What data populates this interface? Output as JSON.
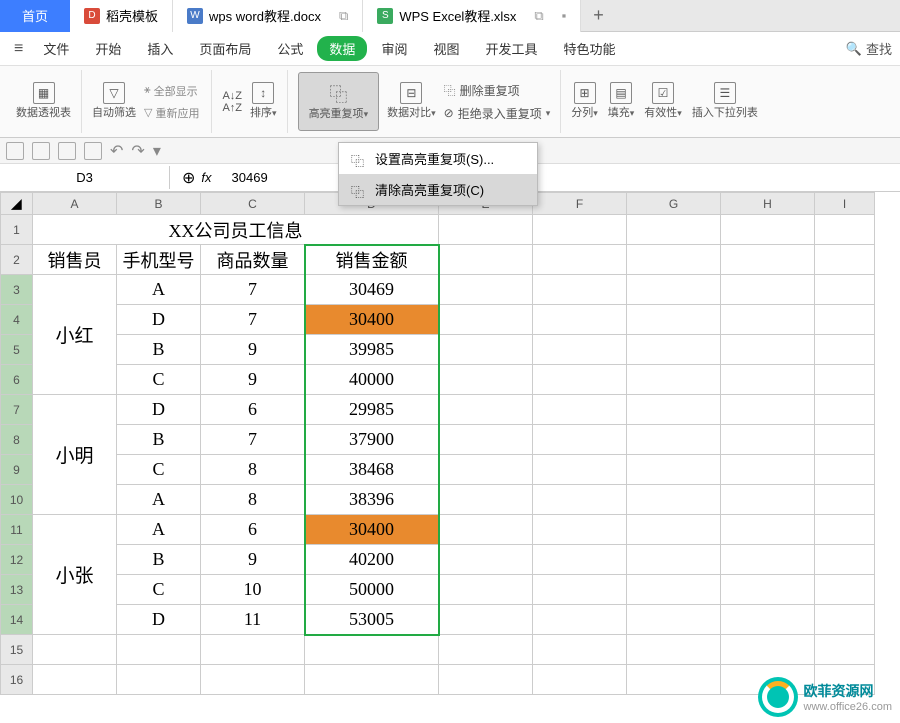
{
  "tabs": {
    "home": "首页",
    "items": [
      {
        "icon": "red",
        "letter": "D",
        "label": "稻壳模板"
      },
      {
        "icon": "blue",
        "letter": "W",
        "label": "wps word教程.docx"
      },
      {
        "icon": "green",
        "letter": "S",
        "label": "WPS Excel教程.xlsx"
      }
    ]
  },
  "menu": {
    "items": [
      "文件",
      "开始",
      "插入",
      "页面布局",
      "公式",
      "数据",
      "审阅",
      "视图",
      "开发工具",
      "特色功能"
    ],
    "active_index": 5,
    "search": "查找"
  },
  "toolbar": {
    "pivot": "数据透视表",
    "autofilter": "自动筛选",
    "show_all": "全部显示",
    "reapply": "重新应用",
    "sort": "排序",
    "highlight_dup": "高亮重复项",
    "compare": "数据对比",
    "remove_dup": "删除重复项",
    "reject_dup": "拒绝录入重复项",
    "split": "分列",
    "fill": "填充",
    "validation": "有效性",
    "insert_dropdown": "插入下拉列表"
  },
  "dropdown": {
    "set": "设置高亮重复项(S)...",
    "clear": "清除高亮重复项(C)"
  },
  "formula": {
    "cell": "D3",
    "value": "30469"
  },
  "sheet": {
    "columns": [
      "A",
      "B",
      "C",
      "D",
      "E",
      "F",
      "G",
      "H",
      "I"
    ],
    "title": "XX公司员工信息",
    "headers": [
      "销售员",
      "手机型号",
      "商品数量",
      "销售金额"
    ],
    "rows": [
      {
        "name": "小红",
        "span": 4,
        "items": [
          {
            "model": "A",
            "qty": "7",
            "amount": "30469",
            "dup": false
          },
          {
            "model": "D",
            "qty": "7",
            "amount": "30400",
            "dup": true
          },
          {
            "model": "B",
            "qty": "9",
            "amount": "39985",
            "dup": false
          },
          {
            "model": "C",
            "qty": "9",
            "amount": "40000",
            "dup": false
          }
        ]
      },
      {
        "name": "小明",
        "span": 4,
        "items": [
          {
            "model": "D",
            "qty": "6",
            "amount": "29985",
            "dup": false
          },
          {
            "model": "B",
            "qty": "7",
            "amount": "37900",
            "dup": false
          },
          {
            "model": "C",
            "qty": "8",
            "amount": "38468",
            "dup": false
          },
          {
            "model": "A",
            "qty": "8",
            "amount": "38396",
            "dup": false
          }
        ]
      },
      {
        "name": "小张",
        "span": 4,
        "items": [
          {
            "model": "A",
            "qty": "6",
            "amount": "30400",
            "dup": true
          },
          {
            "model": "B",
            "qty": "9",
            "amount": "40200",
            "dup": false
          },
          {
            "model": "C",
            "qty": "10",
            "amount": "50000",
            "dup": false
          },
          {
            "model": "D",
            "qty": "11",
            "amount": "53005",
            "dup": false
          }
        ]
      }
    ]
  },
  "watermark": {
    "title": "欧菲资源网",
    "url": "www.office26.com"
  },
  "colors": {
    "accent": "#22b24c",
    "tab_blue": "#3d7eff",
    "dup_highlight": "#e88a2e",
    "selection": "#22aa44"
  }
}
